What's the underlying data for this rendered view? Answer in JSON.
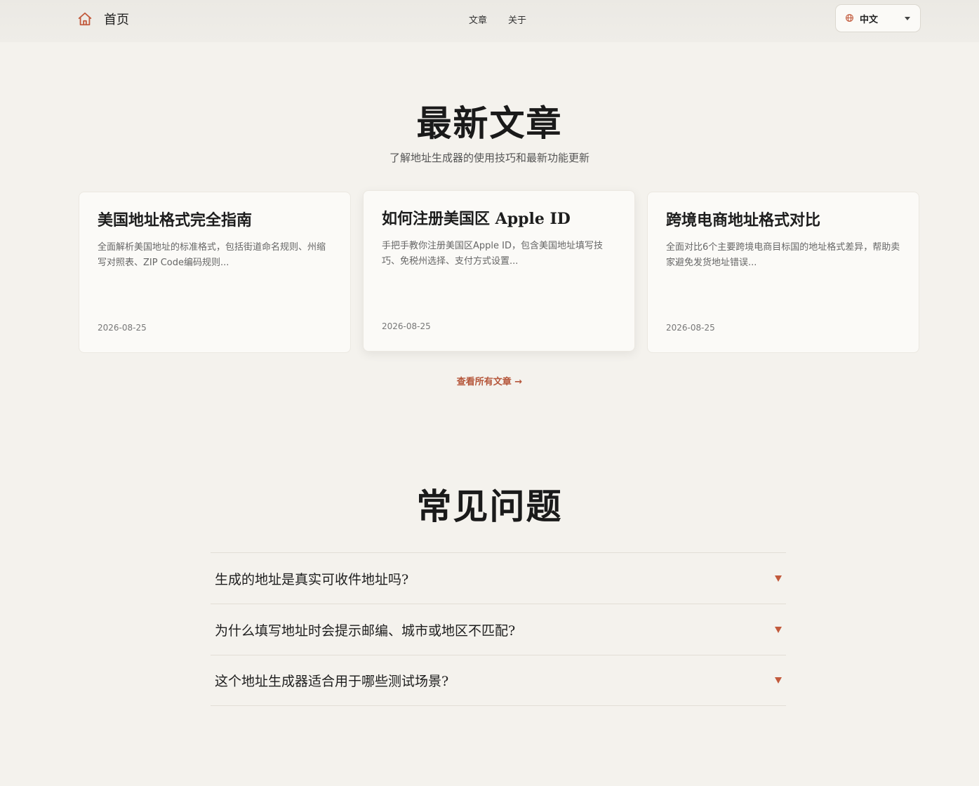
{
  "header": {
    "home_label": "首页",
    "nav": [
      {
        "label": "文章"
      },
      {
        "label": "关于"
      }
    ],
    "language": {
      "label": "中文",
      "icon": "globe-icon"
    },
    "accent": "#c25a3c"
  },
  "articles": {
    "title": "最新文章",
    "subtitle": "了解地址生成器的使用技巧和最新功能更新",
    "cards": [
      {
        "title": "美国地址格式完全指南",
        "excerpt": "全面解析美国地址的标准格式，包括街道命名规则、州缩写对照表、ZIP Code编码规则...",
        "date": "2026-08-25"
      },
      {
        "title": "如何注册美国区 Apple ID",
        "excerpt": "手把手教你注册美国区Apple ID，包含美国地址填写技巧、免税州选择、支付方式设置...",
        "date": "2026-08-25"
      },
      {
        "title": "跨境电商地址格式对比",
        "excerpt": "全面对比6个主要跨境电商目标国的地址格式差异，帮助卖家避免发货地址错误...",
        "date": "2026-08-25"
      }
    ],
    "view_all": "查看所有文章 →"
  },
  "faq": {
    "title": "常见问题",
    "items": [
      {
        "question": "生成的地址是真实可收件地址吗?"
      },
      {
        "question": "为什么填写地址时会提示邮编、城市或地区不匹配?"
      },
      {
        "question": "这个地址生成器适合用于哪些测试场景?"
      }
    ]
  }
}
